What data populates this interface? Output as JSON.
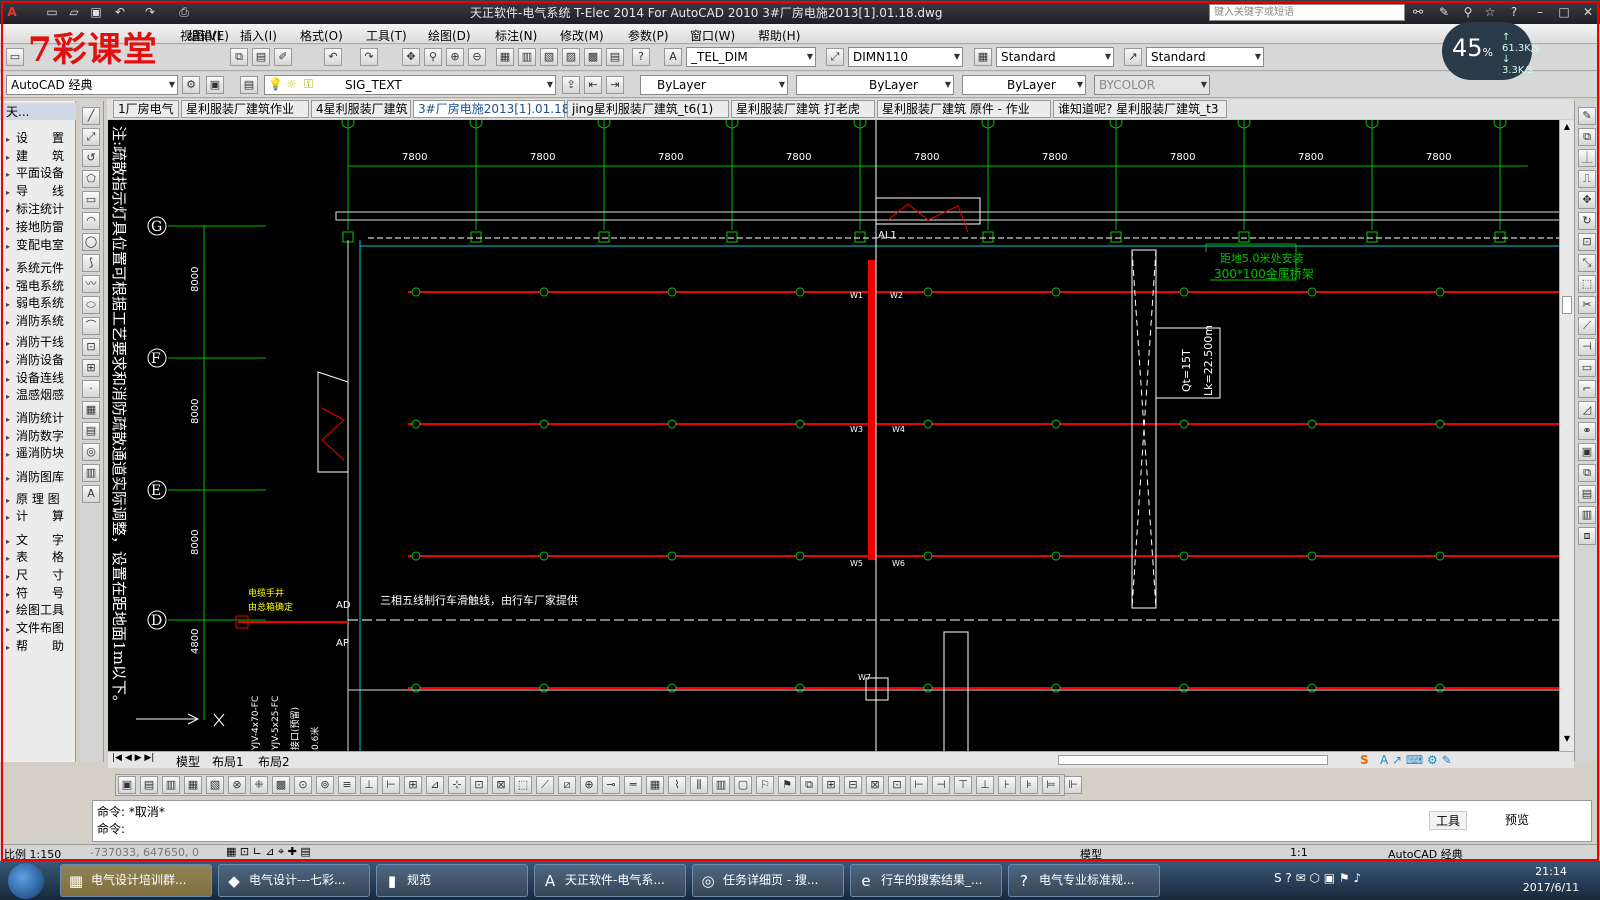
{
  "window": {
    "title": "天正软件-电气系统 T-Elec 2014  For AutoCAD 2010    3#厂房电施2013[1].01.18.dwg",
    "search_placeholder": "键入关键字或短语"
  },
  "watermark": "7彩课堂",
  "menus": [
    "编辑(E)",
    "视图(V)",
    "插入(I)",
    "格式(O)",
    "工具(T)",
    "绘图(D)",
    "标注(N)",
    "修改(M)",
    "参数(P)",
    "窗口(W)",
    "帮助(H)"
  ],
  "toolbar1": {
    "text_style": "_TEL_DIM",
    "dim_style": "DIMN110",
    "table_style": "Standard",
    "multileader_style": "Standard"
  },
  "toolbar2": {
    "workspace": "AutoCAD 经典",
    "layer": "SIG_TEXT",
    "color": "ByLayer",
    "linetype": "ByLayer",
    "lineweight": "ByLayer",
    "plotstyle": "BYCOLOR"
  },
  "network": {
    "percent": "45",
    "percent_unit": "%",
    "up": "61.3K/s",
    "down": "3.3K/s"
  },
  "left_panel": {
    "header": "天...",
    "items": [
      "设　　置",
      "建　　筑",
      "平面设备",
      "导　　线",
      "标注统计",
      "接地防雷",
      "变配电室",
      "系统元件",
      "强电系统",
      "弱电系统",
      "消防系统",
      "消防干线",
      "消防设备",
      "设备连线",
      "温感烟感",
      "消防统计",
      "消防数字",
      "遥消防块",
      "消防图库",
      "原 理 图",
      "计　　算",
      "文　　字",
      "表　　格",
      "尺　　寸",
      "符　　号",
      "绘图工具",
      "文件布图",
      "帮　　助"
    ]
  },
  "doc_tabs": [
    "1厂房电气",
    "星利服装厂建筑作业",
    "4星利服装厂建筑",
    "3#厂房电施2013[1].01.18",
    "jing星利服装厂建筑_t6(1)",
    "星利服装厂建筑 打老虎",
    "星利服装厂建筑 原件 - 作业",
    "谁知道呢? 星利服装厂建筑_t3"
  ],
  "active_doc_tab": 3,
  "drawing": {
    "dims": [
      "7800",
      "7800",
      "7800",
      "7800",
      "7800",
      "7800",
      "7800",
      "7800",
      "7800"
    ],
    "vdims": [
      "8000",
      "8000",
      "8000",
      "4800",
      "8000"
    ],
    "axes": [
      "G",
      "F",
      "E",
      "D"
    ],
    "vertical_note": "注:疏散指示灯具位置可根据工艺要求和消防疏散通道实际调整，设置在距地面1m以下。",
    "label_al1": "AL1",
    "label_w": [
      "W1",
      "W2",
      "W3",
      "W4",
      "W5",
      "W6",
      "W7"
    ],
    "callout1": "距地5.0米处安装",
    "callout2": "300*100金属桥架",
    "crane1": "Qt=15T",
    "crane2": "Lk=22.500m",
    "note_crane": "三相五线制行车滑触线，由行车厂家提供",
    "label_ad": "AD",
    "label_ap": "AP",
    "small1": "电缆手井",
    "small2": "由总箱确定",
    "vert1": "YJV-4x70-FC",
    "vert2": "YJV-5x25-FC",
    "vert3": "接口(预留)",
    "vert4": "0.6米"
  },
  "layout_tabs": [
    "模型",
    "布局1",
    "布局2"
  ],
  "command": {
    "line1": "命令: *取消*",
    "line2": "命令:"
  },
  "cmd_tools": {
    "tool": "工具",
    "preview": "预览"
  },
  "status": {
    "scale": "比例 1:150",
    "coords": "-737033, 647650, 0",
    "model": "模型",
    "ratio": "1:1",
    "workspace": "AutoCAD 经典"
  },
  "taskbar": {
    "items": [
      "电气设计培训群...",
      "电气设计---七彩...",
      "规范",
      "天正软件-电气系...",
      "任务详细页 - 搜...",
      "行车的搜索结果_...",
      "电气专业标准规..."
    ],
    "active": 0,
    "time": "21:14",
    "date": "2017/6/11"
  }
}
